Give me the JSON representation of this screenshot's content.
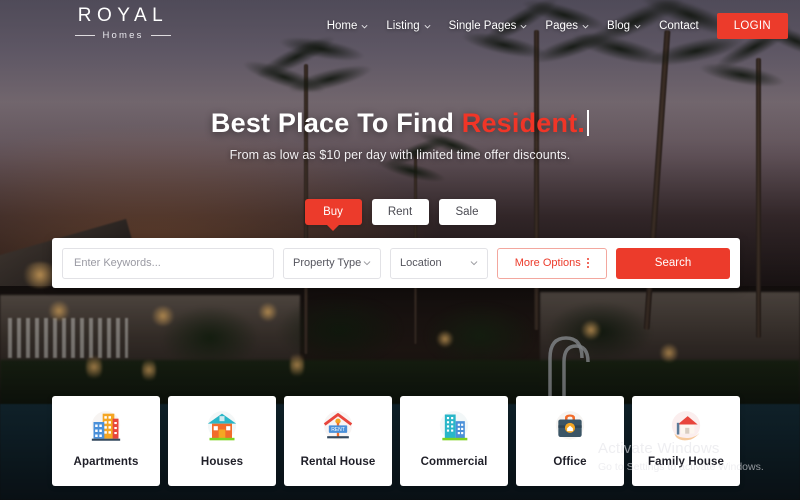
{
  "brand": {
    "name": "ROYAL",
    "tagline": "Homes"
  },
  "nav": {
    "items": [
      {
        "label": "Home",
        "has_dropdown": true
      },
      {
        "label": "Listing",
        "has_dropdown": true
      },
      {
        "label": "Single Pages",
        "has_dropdown": true
      },
      {
        "label": "Pages",
        "has_dropdown": true
      },
      {
        "label": "Blog",
        "has_dropdown": true
      },
      {
        "label": "Contact",
        "has_dropdown": false
      }
    ],
    "login_label": "LOGIN"
  },
  "hero": {
    "headline_static": "Best Place To Find ",
    "headline_accent": "Resident.",
    "subheadline": "From as low as $10 per day with limited time offer discounts.",
    "tabs": [
      {
        "label": "Buy",
        "active": true
      },
      {
        "label": "Rent",
        "active": false
      },
      {
        "label": "Sale",
        "active": false
      }
    ]
  },
  "search": {
    "keywords_placeholder": "Enter Keywords...",
    "keywords_value": "",
    "property_type_label": "Property Type",
    "location_label": "Location",
    "more_options_label": "More Options",
    "search_label": "Search"
  },
  "categories": [
    {
      "label": "Apartments",
      "icon": "apartment-buildings-icon"
    },
    {
      "label": "Houses",
      "icon": "house-icon"
    },
    {
      "label": "Rental House",
      "icon": "rental-house-sign-icon"
    },
    {
      "label": "Commercial",
      "icon": "commercial-buildings-icon"
    },
    {
      "label": "Office",
      "icon": "briefcase-office-icon"
    },
    {
      "label": "Family House",
      "icon": "family-house-hand-icon"
    }
  ],
  "watermark": {
    "title": "Activate Windows",
    "subtitle": "Go to Settings to activate Windows."
  },
  "colors": {
    "accent_red": "#ec3b2b",
    "panel_white": "#ffffff",
    "text_dark": "#1f1f28"
  }
}
